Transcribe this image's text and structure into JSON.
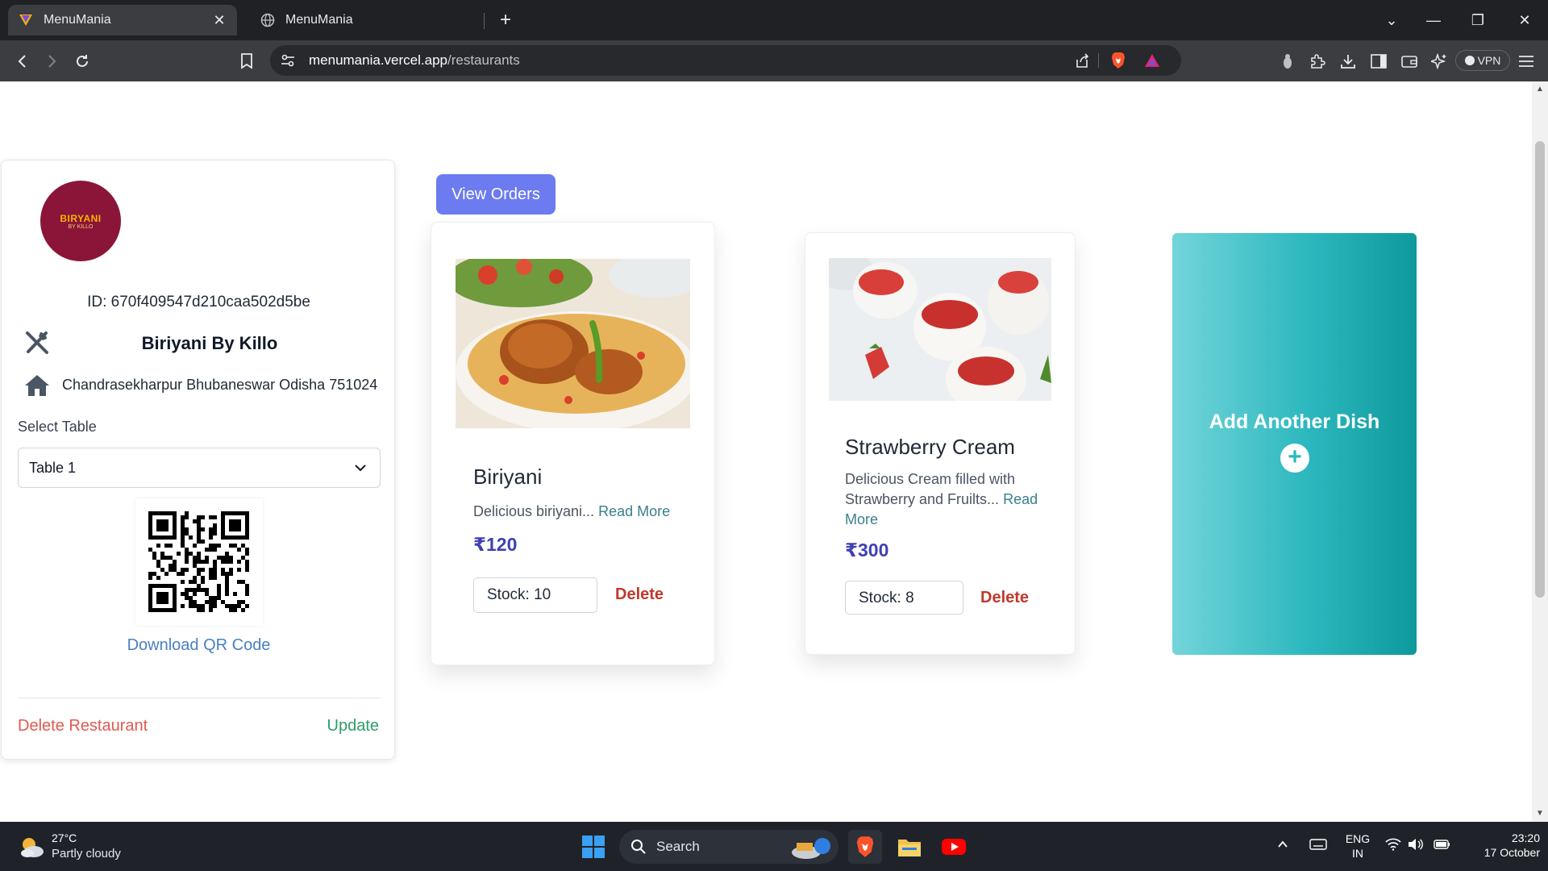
{
  "browser": {
    "tabs": [
      {
        "title": "MenuMania",
        "active": true
      },
      {
        "title": "MenuMania",
        "active": false
      }
    ],
    "url_host": "menumania.vercel.app",
    "url_path": "/restaurants",
    "vpn_label": "VPN"
  },
  "restaurant": {
    "id_label": "ID: 670f409547d210caa502d5be",
    "name": "Biriyani By Killo",
    "address": "Chandrasekharpur Bhubaneswar Odisha 751024",
    "logo_text": "BIRYANI",
    "logo_sub": "BY KILLO",
    "select_label": "Select Table",
    "selected_table": "Table 1",
    "download_qr": "Download QR Code",
    "delete_label": "Delete Restaurant",
    "update_label": "Update"
  },
  "actions": {
    "view_orders": "View Orders",
    "add_dish": "Add Another Dish"
  },
  "dishes": [
    {
      "name": "Biriyani",
      "desc": "Delicious biriyani...",
      "read_more": "Read More",
      "price": "₹120",
      "stock": "Stock: 10",
      "delete": "Delete"
    },
    {
      "name": "Strawberry Cream",
      "desc_line1": "Delicious Cream filled with",
      "desc_line2": "Strawberry and Fruilts...",
      "read_more_a": "Read",
      "read_more_b": "More",
      "price": "₹300",
      "stock": "Stock: 8",
      "delete": "Delete"
    }
  ],
  "taskbar": {
    "temperature": "27°C",
    "weather": "Partly cloudy",
    "search": "Search",
    "lang_top": "ENG",
    "lang_bottom": "IN",
    "time": "23:20",
    "date": "17 October"
  },
  "colors": {
    "accent_button": "#6c7bef",
    "delete_red": "#c0392b",
    "price_indigo": "#3f3fb5",
    "teal_gradient_start": "#73d5db",
    "teal_gradient_end": "#0e999d"
  }
}
